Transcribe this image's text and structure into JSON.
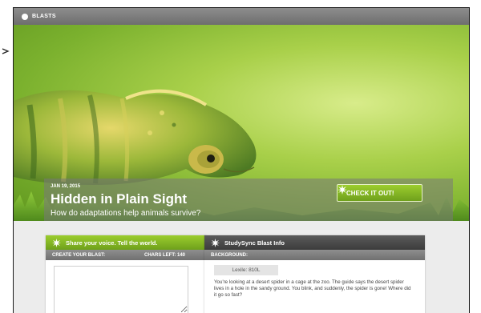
{
  "topbar": {
    "label": "BLASTS",
    "icon": "blast-dot-icon"
  },
  "hero": {
    "date": "JAN 19, 2015",
    "title": "Hidden in Plain Sight",
    "subtitle": "How do adaptations help animals survive?",
    "cta_label": "CHECK IT OUT!",
    "image_subject": "chameleon"
  },
  "share_panel": {
    "heading": "Share your voice. Tell the world.",
    "create_label": "CREATE YOUR BLAST:",
    "chars_left": "CHARS LEFT: 140",
    "blast_value": ""
  },
  "info_panel": {
    "heading": "StudySync Blast Info",
    "background_label": "BACKGROUND:",
    "lexile": "Lexile: 810L",
    "background_text": "You're looking at a desert spider in a cage at the zoo. The guide says the desert spider lives in a hole in the sandy ground. You blink, and suddenly, the spider is gone! Where did it go so fast?"
  },
  "colors": {
    "accent_green": "#8cc12a",
    "dark_header": "#4a4a4a",
    "bar_gray": "#7d7d7d"
  }
}
